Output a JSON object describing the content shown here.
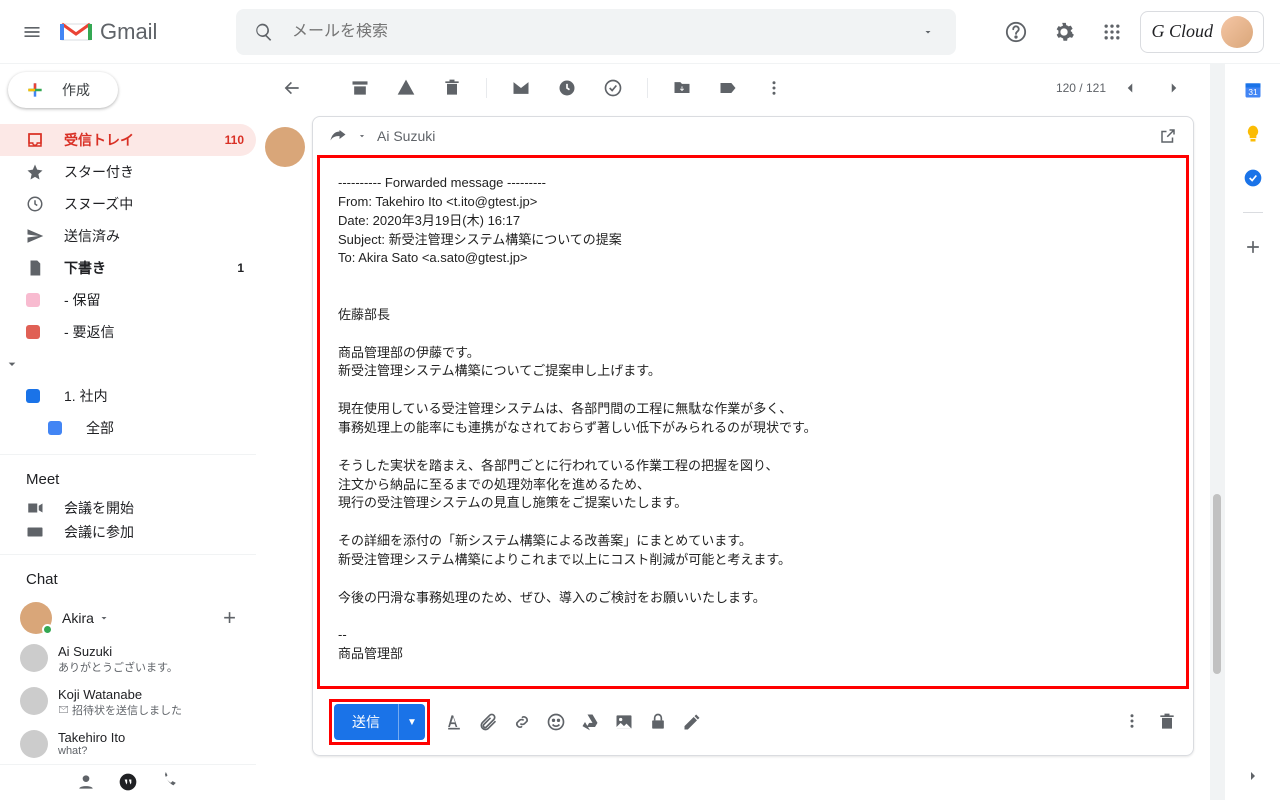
{
  "header": {
    "product": "Gmail",
    "search_placeholder": "メールを検索",
    "account_label": "G Cloud"
  },
  "compose_button": "作成",
  "nav": [
    {
      "label": "受信トレイ",
      "badge": "110",
      "icon": "inbox",
      "active": true
    },
    {
      "label": "スター付き",
      "icon": "star"
    },
    {
      "label": "スヌーズ中",
      "icon": "clock"
    },
    {
      "label": "送信済み",
      "icon": "send"
    },
    {
      "label": "下書き",
      "badge": "1",
      "icon": "file",
      "bold": true
    },
    {
      "label": "- 保留",
      "icon": "label",
      "color": "#f8bbd0"
    },
    {
      "label": "- 要返信",
      "icon": "label",
      "color": "#e06055"
    },
    {
      "label": "1. 社内",
      "icon": "label",
      "color": "#1a73e8"
    },
    {
      "label": "全部",
      "icon": "label",
      "color": "#4285f4",
      "indent": true
    }
  ],
  "meet": {
    "title": "Meet",
    "start": "会議を開始",
    "join": "会議に参加"
  },
  "chat": {
    "title": "Chat",
    "me": "Akira",
    "items": [
      {
        "name": "Ai Suzuki",
        "sub": "ありがとうございます。"
      },
      {
        "name": "Koji Watanabe",
        "sub": "招待状を送信しました",
        "mail_icon": true
      },
      {
        "name": "Takehiro Ito",
        "sub": "what?"
      }
    ]
  },
  "toolbar": {
    "counter": "120 / 121"
  },
  "compose": {
    "recipient": "Ai Suzuki",
    "body": "---------- Forwarded message ---------\nFrom: Takehiro Ito <t.ito@gtest.jp>\nDate: 2020年3月19日(木) 16:17\nSubject: 新受注管理システム構築についての提案\nTo: Akira Sato <a.sato@gtest.jp>\n\n\n佐藤部長\n\n商品管理部の伊藤です。\n新受注管理システム構築についてご提案申し上げます。\n\n現在使用している受注管理システムは、各部門間の工程に無駄な作業が多く、\n事務処理上の能率にも連携がなされておらず著しい低下がみられるのが現状です。\n\nそうした実状を踏まえ、各部門ごとに行われている作業工程の把握を図り、\n注文から納品に至るまでの処理効率化を進めるため、\n現行の受注管理システムの見直し施策をご提案いたします。\n\nその詳細を添付の「新システム構築による改善案」にまとめています。\n新受注管理システム構築によりこれまで以上にコスト削減が可能と考えます。\n\n今後の円滑な事務処理のため、ぜひ、導入のご検討をお願いいたします。\n\n-- \n商品管理部",
    "send_label": "送信"
  }
}
